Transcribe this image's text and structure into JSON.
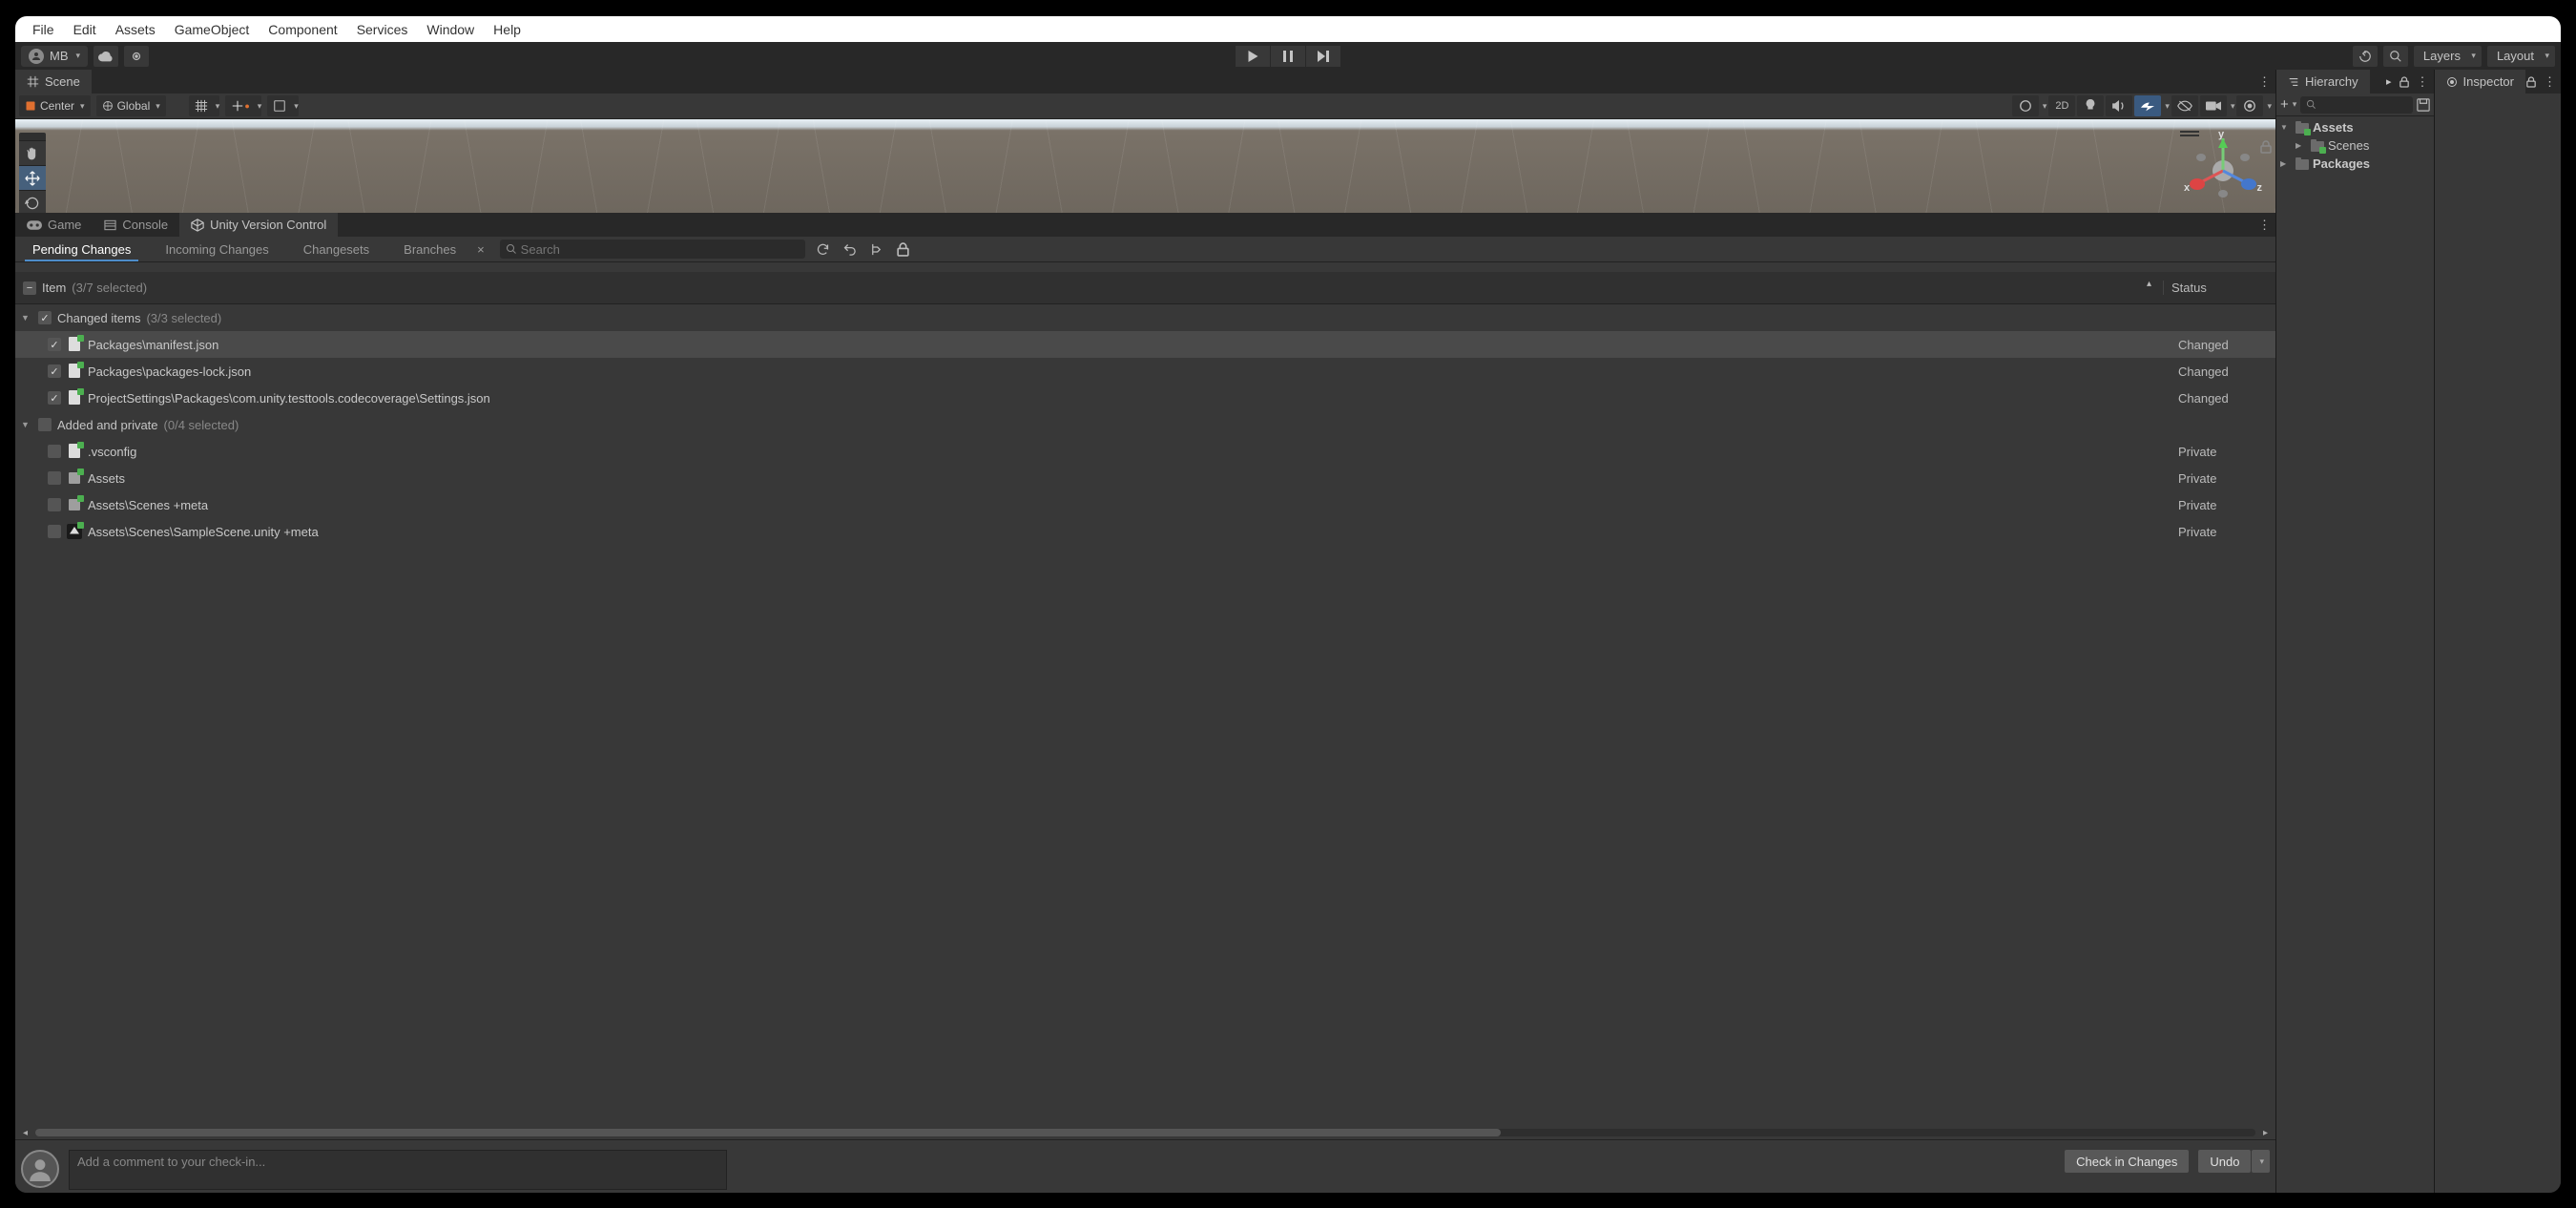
{
  "menubar": [
    "File",
    "Edit",
    "Assets",
    "GameObject",
    "Component",
    "Services",
    "Window",
    "Help"
  ],
  "toolbar": {
    "account_label": "MB",
    "layers_label": "Layers",
    "layout_label": "Layout"
  },
  "scene_tab": "Scene",
  "scene_toolbar": {
    "pivot": "Center",
    "handle": "Global",
    "mode2d": "2D"
  },
  "gizmo": {
    "x": "x",
    "y": "y",
    "z": "z"
  },
  "bottom_tabs": {
    "game": "Game",
    "console": "Console",
    "uvc": "Unity Version Control"
  },
  "vc": {
    "tabs": [
      "Pending Changes",
      "Incoming Changes",
      "Changesets",
      "Branches"
    ],
    "search_placeholder": "Search",
    "columns": {
      "item": "Item",
      "item_count": "(3/7 selected)",
      "status": "Status"
    },
    "sections": [
      {
        "title": "Changed items",
        "count": "(3/3 selected)",
        "checked": true,
        "items": [
          {
            "name": "Packages\\manifest.json",
            "status": "Changed",
            "checked": true,
            "selected": true,
            "icon": "file"
          },
          {
            "name": "Packages\\packages-lock.json",
            "status": "Changed",
            "checked": true,
            "icon": "file"
          },
          {
            "name": "ProjectSettings\\Packages\\com.unity.testtools.codecoverage\\Settings.json",
            "status": "Changed",
            "checked": true,
            "icon": "file"
          }
        ]
      },
      {
        "title": "Added and private",
        "count": "(0/4 selected)",
        "checked": false,
        "items": [
          {
            "name": ".vsconfig",
            "status": "Private",
            "checked": false,
            "icon": "file"
          },
          {
            "name": "Assets",
            "status": "Private",
            "checked": false,
            "icon": "folder"
          },
          {
            "name": "Assets\\Scenes +meta",
            "status": "Private",
            "checked": false,
            "icon": "folder"
          },
          {
            "name": "Assets\\Scenes\\SampleScene.unity +meta",
            "status": "Private",
            "checked": false,
            "icon": "unity"
          }
        ]
      }
    ],
    "comment_placeholder": "Add a comment to your check-in...",
    "checkin_btn": "Check in Changes",
    "undo_btn": "Undo"
  },
  "hierarchy": {
    "title": "Hierarchy",
    "items": [
      {
        "label": "Assets",
        "depth": 0,
        "expanded": true,
        "icon": "assets-folder"
      },
      {
        "label": "Scenes",
        "depth": 1,
        "expanded": false,
        "icon": "assets-folder"
      },
      {
        "label": "Packages",
        "depth": 0,
        "expanded": false,
        "icon": "folder"
      }
    ]
  },
  "inspector": {
    "title": "Inspector"
  }
}
